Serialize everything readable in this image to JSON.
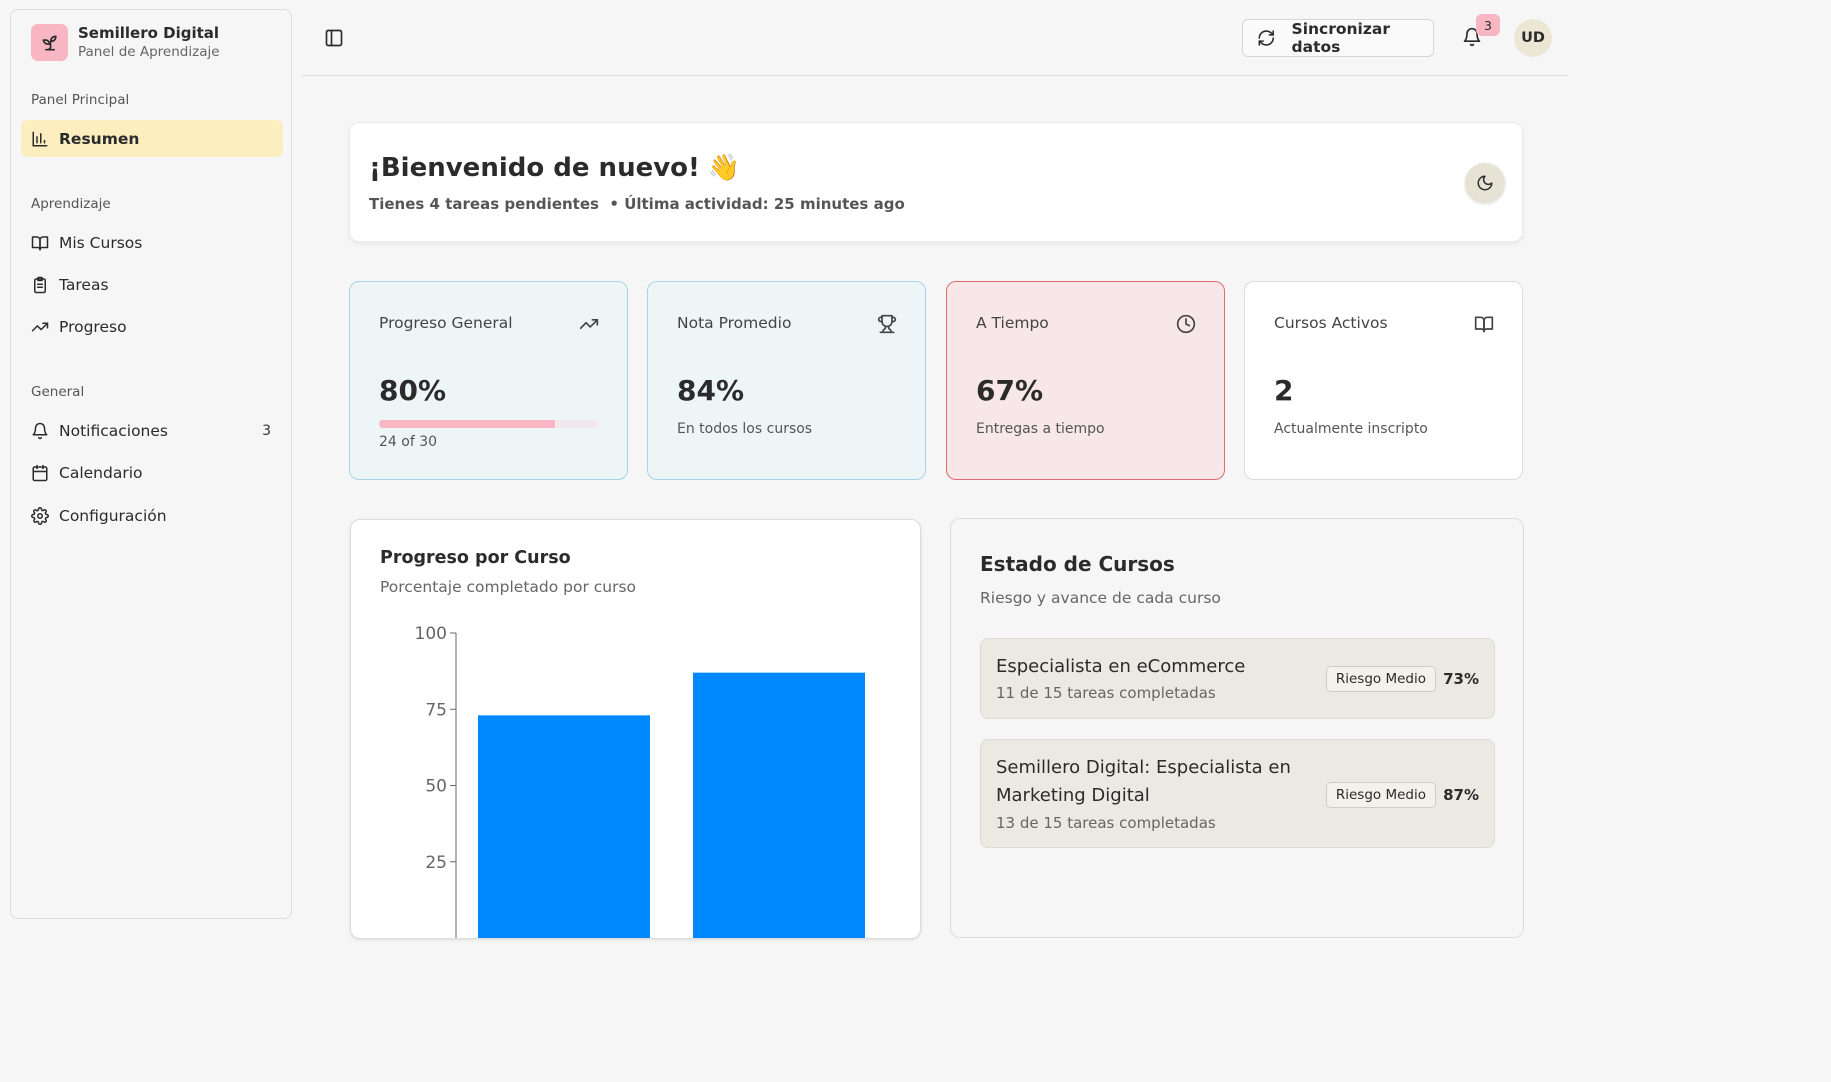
{
  "sidebar": {
    "brand_title": "Semillero Digital",
    "brand_subtitle": "Panel de Aprendizaje",
    "sections": {
      "main": "Panel Principal",
      "learning": "Aprendizaje",
      "general": "General"
    },
    "items": {
      "summary": "Resumen",
      "courses": "Mis Cursos",
      "tasks": "Tareas",
      "progress": "Progreso",
      "notifications": "Notificaciones",
      "notifications_count": "3",
      "calendar": "Calendario",
      "settings": "Configuración"
    }
  },
  "topbar": {
    "sync_label": "Sincronizar datos",
    "notification_badge": "3",
    "avatar_initials": "UD"
  },
  "welcome": {
    "title": "¡Bienvenido de nuevo!",
    "emoji": "👋",
    "subtitle": "Tienes 4 tareas pendientes  • Última actividad: 25 minutes ago"
  },
  "stats": {
    "overall": {
      "title": "Progreso General",
      "value": "80%",
      "note": "24 of 30",
      "progress": 0.8
    },
    "grade": {
      "title": "Nota Promedio",
      "value": "84%",
      "note": "En todos los cursos"
    },
    "ontime": {
      "title": "A Tiempo",
      "value": "67%",
      "note": "Entregas a tiempo"
    },
    "active": {
      "title": "Cursos Activos",
      "value": "2",
      "note": "Actualmente inscripto"
    }
  },
  "chart": {
    "title": "Progreso por Curso",
    "subtitle": "Porcentaje completado por curso"
  },
  "chart_data": {
    "type": "bar",
    "values": [
      73,
      87
    ],
    "ylim": [
      0,
      100
    ],
    "yticks": [
      "100",
      "75",
      "50",
      "25"
    ],
    "bar_color": "#0088fe"
  },
  "estado": {
    "title": "Estado de Cursos",
    "subtitle": "Riesgo y avance de cada curso",
    "courses": [
      {
        "name": "Especialista en eCommerce",
        "tasks": "11 de 15 tareas completadas",
        "risk": "Riesgo Medio",
        "pct": "73%"
      },
      {
        "name_line1": "Semillero Digital: Especialista en",
        "name_line2": "Marketing Digital",
        "tasks": "13 de 15 tareas completadas",
        "risk": "Riesgo Medio",
        "pct": "87%"
      }
    ]
  },
  "colors": {
    "accent_pink": "#f7b6c2",
    "active_nav": "#fdeec0",
    "card_blue": "#eef5f7",
    "card_red": "#f7e7e8",
    "bar_blue": "#0088fe"
  }
}
